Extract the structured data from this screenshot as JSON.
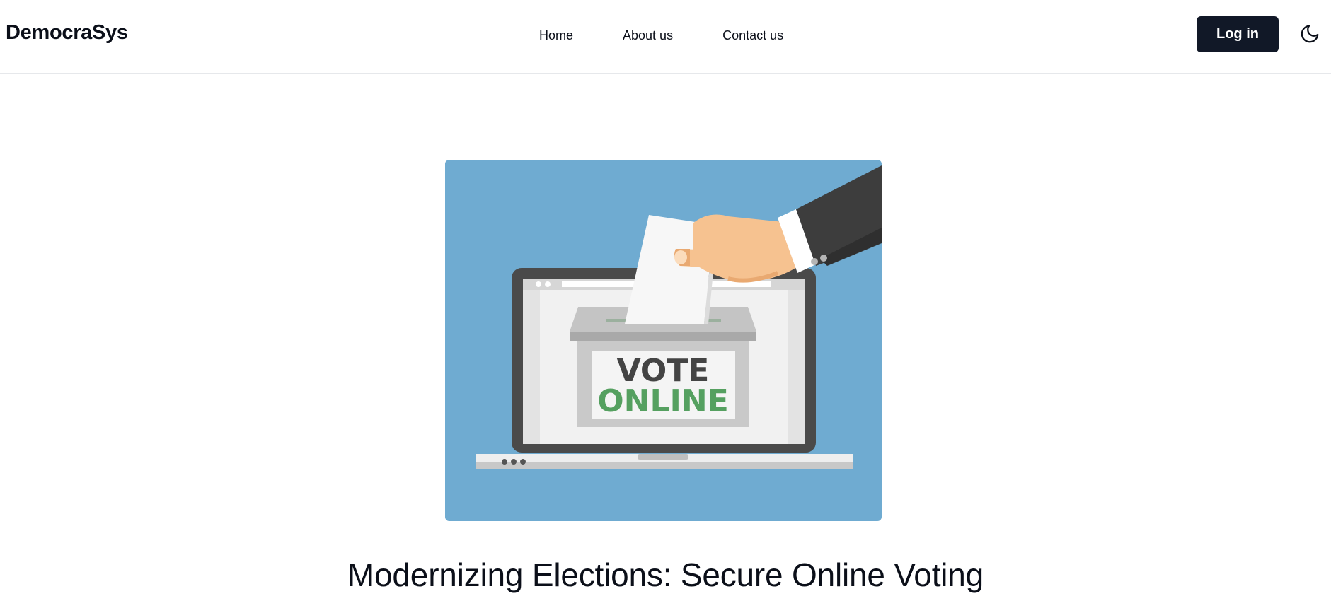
{
  "navbar": {
    "brand": "DemocraSys",
    "links": [
      {
        "label": "Home"
      },
      {
        "label": "About us"
      },
      {
        "label": "Contact us"
      }
    ],
    "login_label": "Log in",
    "theme_toggle_icon": "moon-icon"
  },
  "hero": {
    "image": {
      "vote_word": "VOTE",
      "online_word": "ONLINE"
    },
    "title": "Modernizing Elections: Secure Online Voting",
    "subtitle": ""
  },
  "colors": {
    "primary_button": "#111827",
    "image_bg": "#6fabd1",
    "online_green": "#55a060",
    "vote_dark": "#444444"
  }
}
